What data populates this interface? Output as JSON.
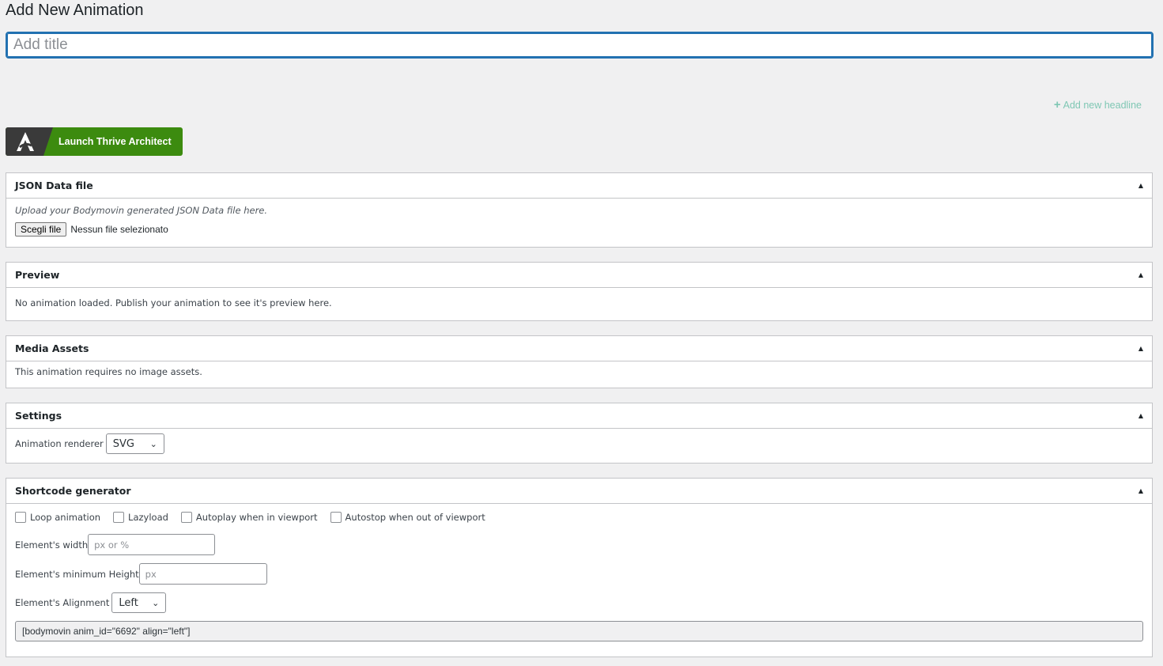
{
  "page": {
    "title": "Add New Animation"
  },
  "title_input": {
    "placeholder": "Add title",
    "value": ""
  },
  "add_headline": {
    "label": "Add new headline",
    "icon": "plus-icon",
    "color": "#7fc7b4"
  },
  "launch_button": {
    "label": "Launch Thrive Architect",
    "icon": "thrive-architect-logo-icon",
    "color": "#3c8b0f"
  },
  "json_box": {
    "title": "JSON Data file",
    "hint": "Upload your Bodymovin generated JSON Data file here.",
    "file_button": "Scegli file",
    "file_status": "Nessun file selezionato"
  },
  "preview_box": {
    "title": "Preview",
    "message": "No animation loaded. Publish your animation to see it's preview here."
  },
  "media_box": {
    "title": "Media Assets",
    "message": "This animation requires no image assets."
  },
  "settings_box": {
    "title": "Settings",
    "renderer_label": "Animation renderer",
    "renderer_value": "SVG"
  },
  "shortcode_box": {
    "title": "Shortcode generator",
    "checkboxes": [
      {
        "label": "Loop animation",
        "checked": false
      },
      {
        "label": "Lazyload",
        "checked": false
      },
      {
        "label": "Autoplay when in viewport",
        "checked": false
      },
      {
        "label": "Autostop when out of viewport",
        "checked": false
      }
    ],
    "width_label": "Element's width",
    "width_placeholder": "px or %",
    "min_height_label": "Element's minimum Height",
    "min_height_placeholder": "px",
    "alignment_label": "Element's Alignment",
    "alignment_value": "Left",
    "shortcode": "[bodymovin anim_id=\"6692\" align=\"left\"]"
  }
}
